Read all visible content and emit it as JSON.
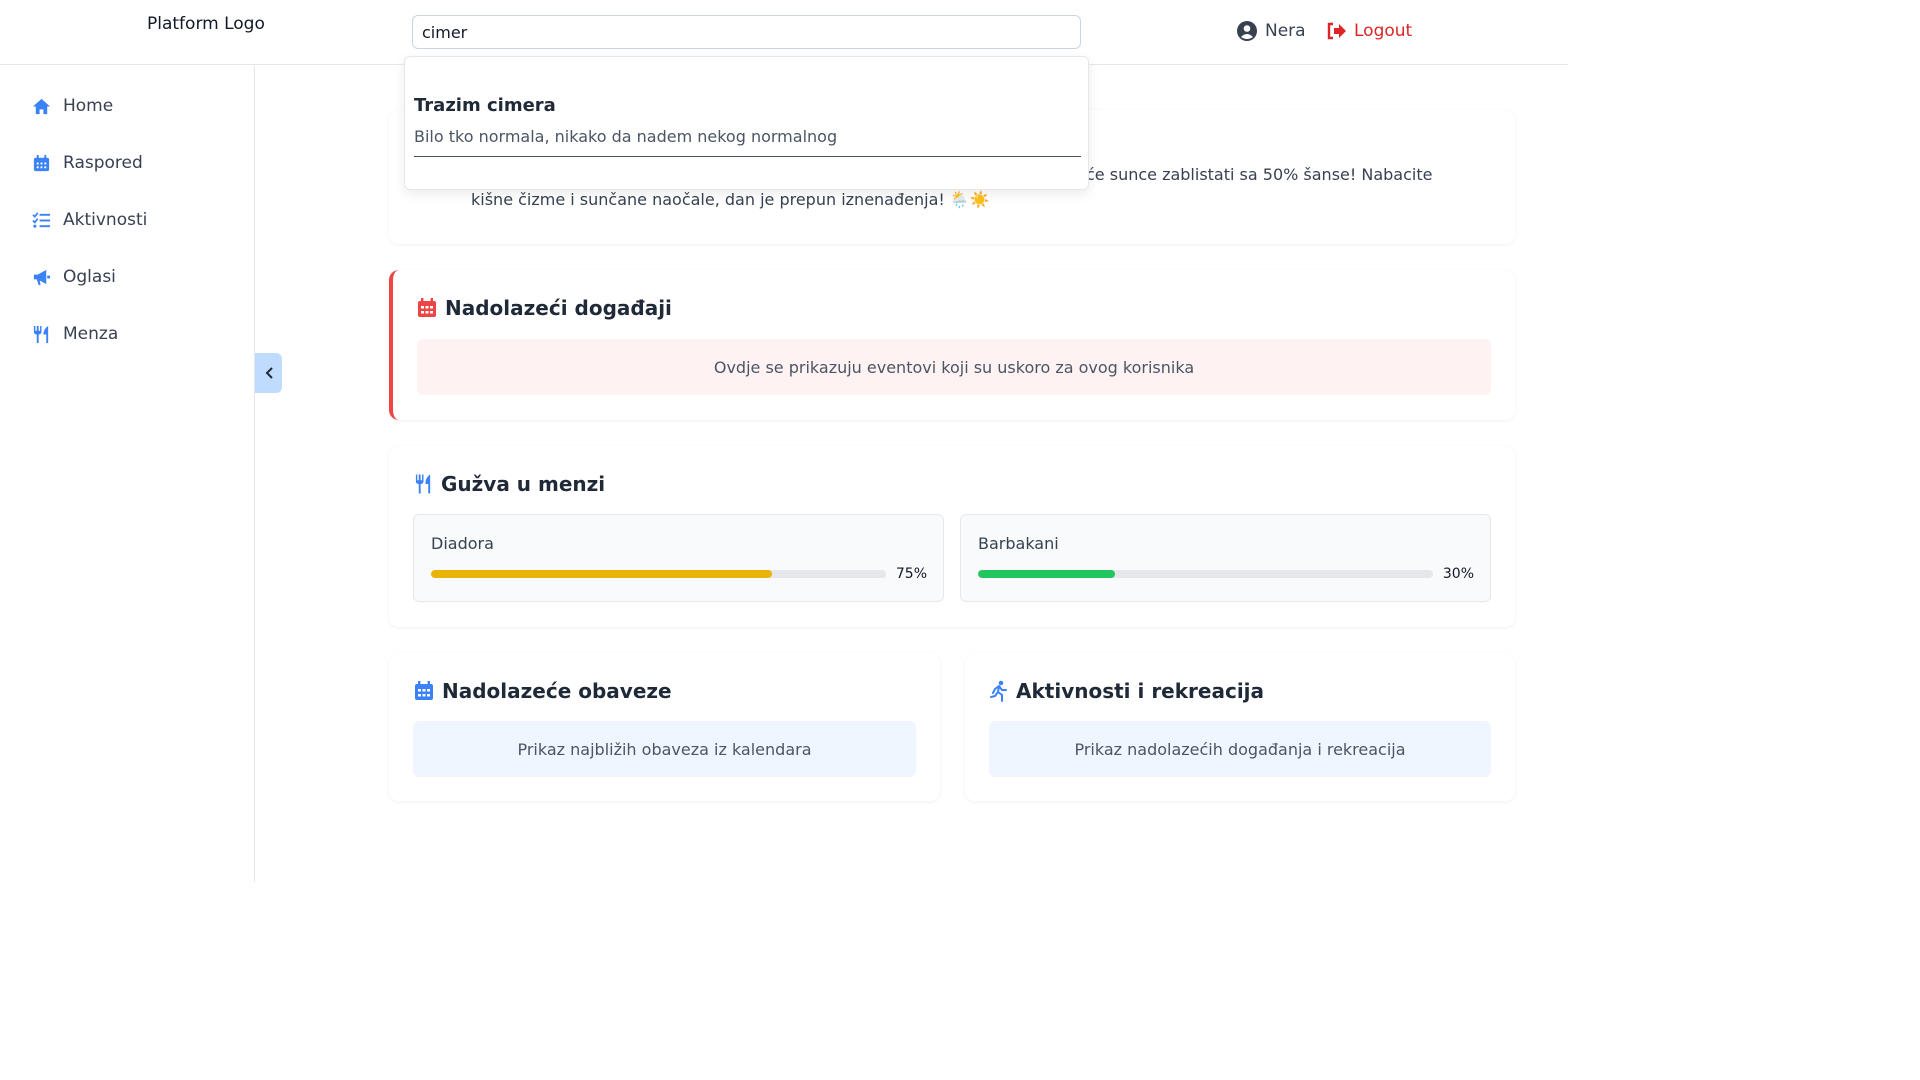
{
  "header": {
    "logo": "Platform Logo",
    "search_value": "cimer",
    "user_name": "Nera",
    "logout_label": "Logout"
  },
  "sidebar": {
    "items": [
      {
        "label": "Home",
        "icon": "home-icon"
      },
      {
        "label": "Raspored",
        "icon": "calendar-icon"
      },
      {
        "label": "Aktivnosti",
        "icon": "list-check-icon"
      },
      {
        "label": "Oglasi",
        "icon": "megaphone-icon"
      },
      {
        "label": "Menza",
        "icon": "utensils-icon"
      }
    ],
    "collapse_icon": "chevron-left-icon"
  },
  "search_dropdown": {
    "result_title": "Trazim cimera",
    "result_description": "Bilo tko normala, nikako da nadem nekog normalnog"
  },
  "weather": {
    "text": "će sunce zablistati sa 50% šanse! Nabacite kišne čizme i sunčane naočale, dan je prepun iznenađenja! 🌦️☀️"
  },
  "events": {
    "title": "Nadolazeći događaji",
    "message": "Ovdje se prikazuju eventovi koji su uskoro za ovog korisnika"
  },
  "menza": {
    "title": "Gužva u menzi",
    "locations": [
      {
        "name": "Diadora",
        "percent_label": "75%",
        "fill": 0.75,
        "color": "#eab308"
      },
      {
        "name": "Barbakani",
        "percent_label": "30%",
        "fill": 0.3,
        "color": "#22c55e"
      }
    ]
  },
  "obligations": {
    "title": "Nadolazeće obaveze",
    "message": "Prikaz najbližih obaveza iz kalendara"
  },
  "activities": {
    "title": "Aktivnosti i rekreacija",
    "message": "Prikaz nadolazećih događanja i rekreacija"
  },
  "colors": {
    "accent": "#3b82f6",
    "danger": "#dc2626",
    "event_bg": "#fef2f2",
    "info_bg": "#eff6ff"
  }
}
